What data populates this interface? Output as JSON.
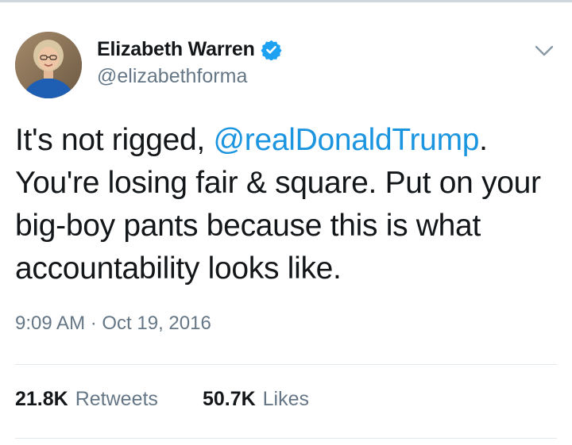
{
  "user": {
    "display_name": "Elizabeth Warren",
    "handle": "@elizabethforma",
    "verified": true
  },
  "tweet": {
    "text_before": "It's not rigged, ",
    "mention": "@realDonaldTrump",
    "text_after": ". You're losing fair & square. Put on your big-boy pants because this is what accountability looks like.",
    "timestamp": "9:09 AM · Oct 19, 2016"
  },
  "stats": {
    "retweets_count": "21.8K",
    "retweets_label": "Retweets",
    "likes_count": "50.7K",
    "likes_label": "Likes"
  },
  "icons": {
    "verified": "verified-badge-icon",
    "menu": "chevron-down-icon"
  },
  "colors": {
    "text": "#14171a",
    "secondary": "#657786",
    "link": "#1b95e0",
    "verified": "#1da1f2",
    "divider": "#e1e8ed"
  }
}
